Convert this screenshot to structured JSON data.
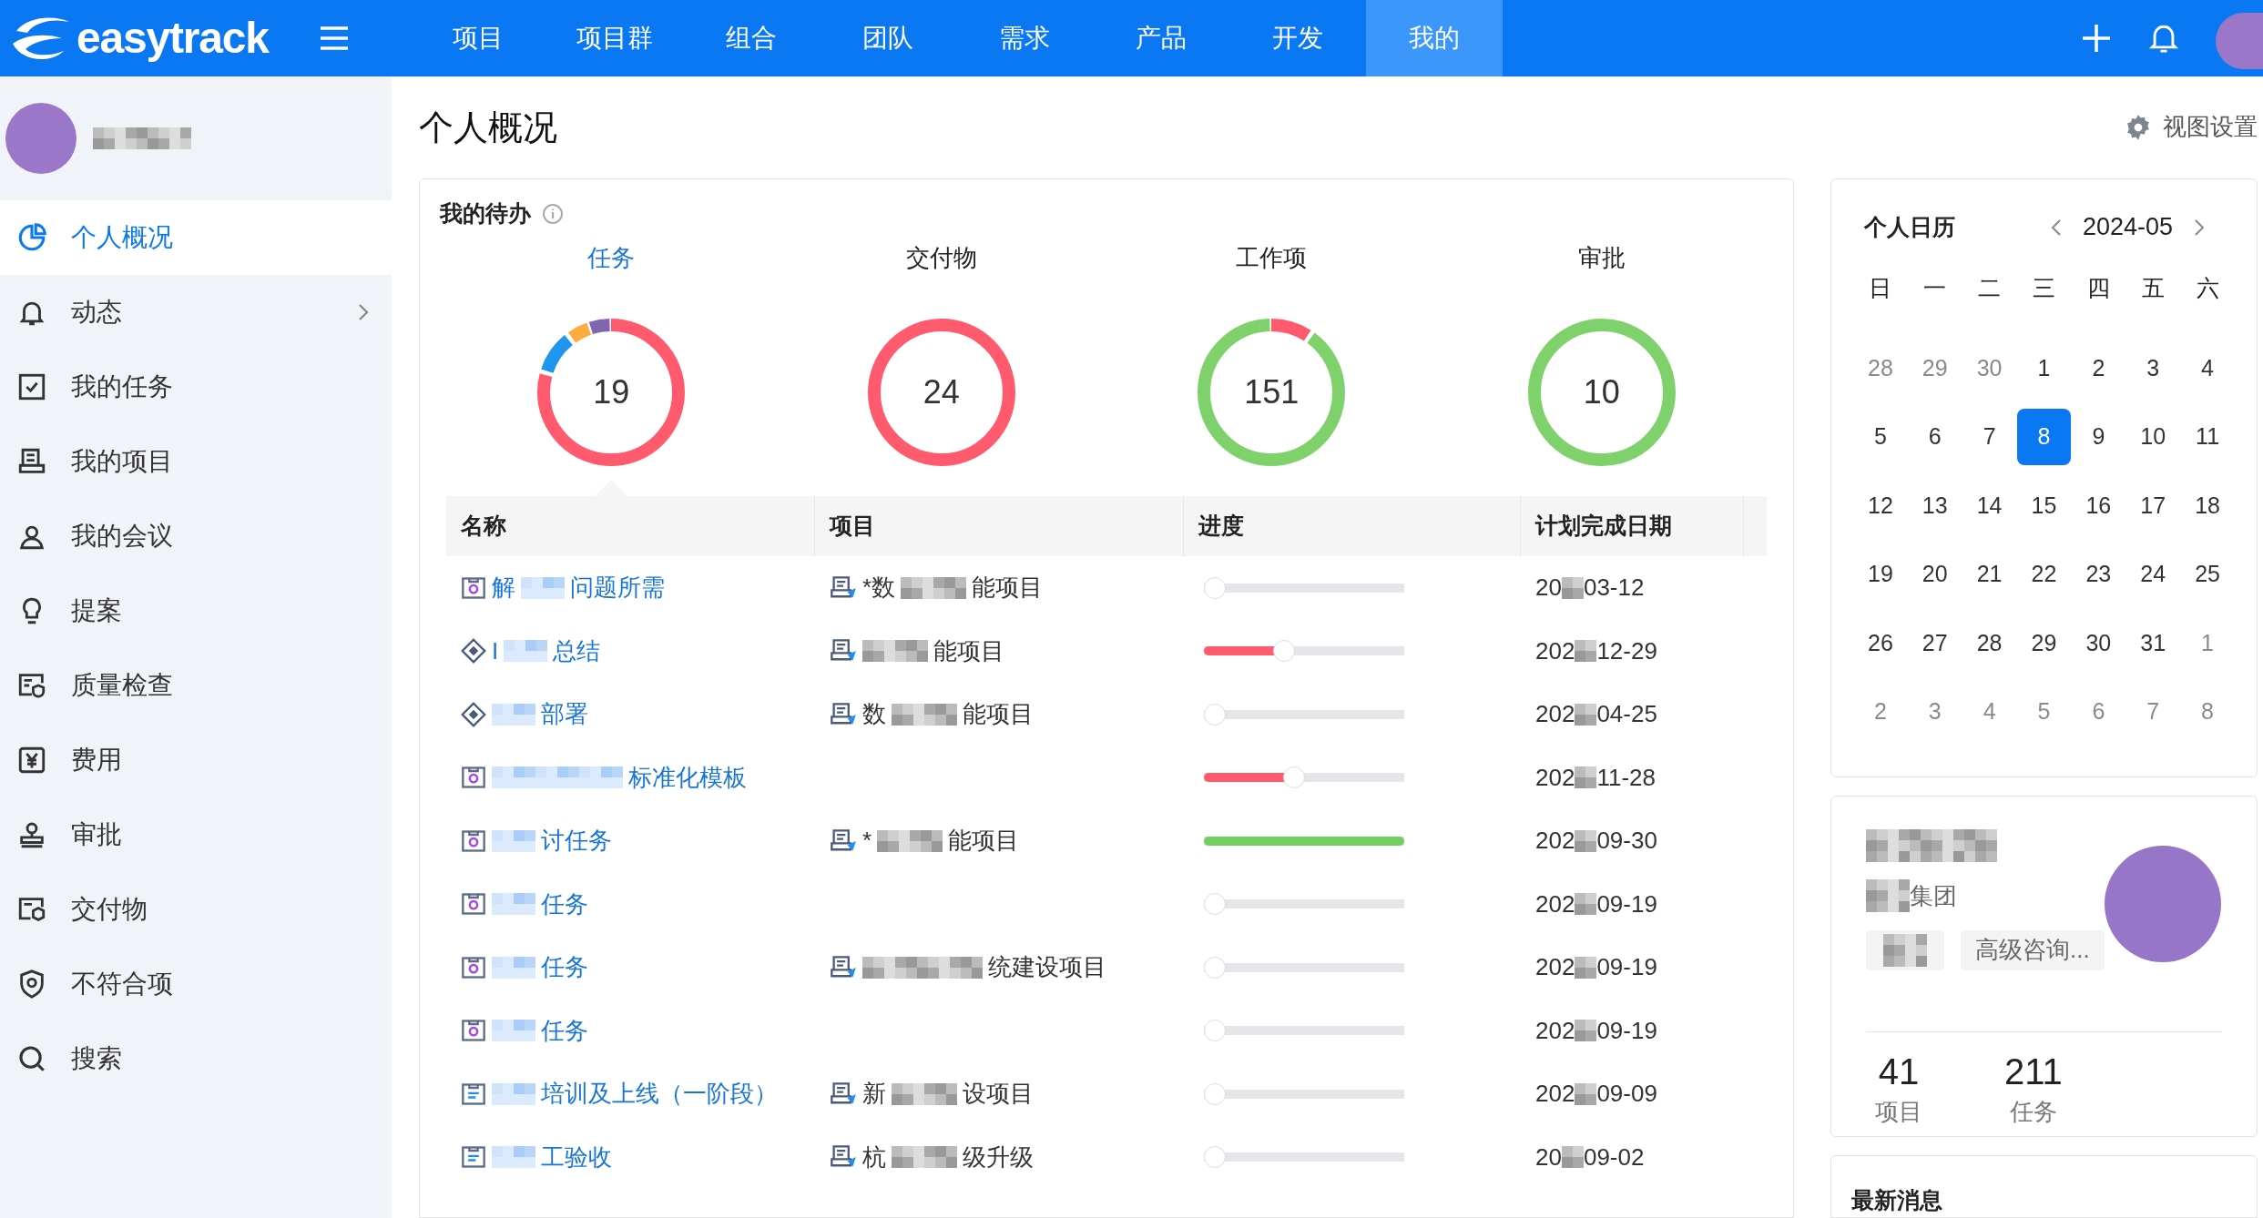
{
  "topbar": {
    "logo": "easytrack",
    "nav": [
      {
        "label": "项目",
        "selected": false
      },
      {
        "label": "项目群",
        "selected": false
      },
      {
        "label": "组合",
        "selected": false
      },
      {
        "label": "团队",
        "selected": false
      },
      {
        "label": "需求",
        "selected": false
      },
      {
        "label": "产品",
        "selected": false
      },
      {
        "label": "开发",
        "selected": false
      },
      {
        "label": "我的",
        "selected": true
      }
    ]
  },
  "sidebar": {
    "items": [
      {
        "label": "个人概况",
        "selected": true,
        "has_children": false
      },
      {
        "label": "动态",
        "selected": false,
        "has_children": true
      },
      {
        "label": "我的任务",
        "selected": false,
        "has_children": false
      },
      {
        "label": "我的项目",
        "selected": false,
        "has_children": false
      },
      {
        "label": "我的会议",
        "selected": false,
        "has_children": false
      },
      {
        "label": "提案",
        "selected": false,
        "has_children": false
      },
      {
        "label": "质量检查",
        "selected": false,
        "has_children": false
      },
      {
        "label": "费用",
        "selected": false,
        "has_children": false
      },
      {
        "label": "审批",
        "selected": false,
        "has_children": false
      },
      {
        "label": "交付物",
        "selected": false,
        "has_children": false
      },
      {
        "label": "不符合项",
        "selected": false,
        "has_children": false
      },
      {
        "label": "搜索",
        "selected": false,
        "has_children": false
      }
    ]
  },
  "page_title": "个人概况",
  "view_settings": "视图设置",
  "todo": {
    "title": "我的待办",
    "tabs": [
      {
        "label": "任务",
        "count": "19",
        "selected": true
      },
      {
        "label": "交付物",
        "count": "24",
        "selected": false
      },
      {
        "label": "工作项",
        "count": "151",
        "selected": false
      },
      {
        "label": "审批",
        "count": "10",
        "selected": false
      }
    ],
    "table": {
      "columns": [
        "名称",
        "项目",
        "进度",
        "计划完成日期"
      ],
      "rows": [
        {
          "kind": "task",
          "name_head": "解",
          "name": "问题所需",
          "project_head": "*数",
          "project": "能项目",
          "level": 0,
          "date_head": "20",
          "date": "03-12"
        },
        {
          "kind": "milestone",
          "name_head": "I",
          "name": "总结",
          "project_head": "",
          "project": "能项目",
          "level": 0.4,
          "date_head": "202",
          "date": "12-29"
        },
        {
          "kind": "milestone",
          "name_head": "",
          "name": "部署",
          "project_head": "数",
          "project": "能项目",
          "level": 0,
          "date_head": "202",
          "date": "04-25"
        },
        {
          "kind": "task",
          "name_head": "",
          "name": "标准化模板",
          "project_head": "",
          "project": "",
          "level": 0.45,
          "date_head": "202",
          "date": "11-28"
        },
        {
          "kind": "task",
          "name_head": "",
          "name": "讨任务",
          "project_head": "*",
          "project": "能项目",
          "level": 1,
          "date_head": "202",
          "date": "09-30"
        },
        {
          "kind": "task",
          "name_head": "",
          "name": "任务",
          "project_head": "",
          "project": "",
          "level": 0,
          "date_head": "202",
          "date": "09-19"
        },
        {
          "kind": "task",
          "name_head": "",
          "name": "任务",
          "project_head": "",
          "project": "统建设项目",
          "level": 0,
          "date_head": "202",
          "date": "09-19"
        },
        {
          "kind": "task",
          "name_head": "",
          "name": "任务",
          "project_head": "",
          "project": "",
          "level": 0,
          "date_head": "202",
          "date": "09-19"
        },
        {
          "kind": "doc",
          "name_head": "",
          "name": "培训及上线（一阶段）",
          "project_head": "新",
          "project": "设项目",
          "level": 0,
          "date_head": "202",
          "date": "09-09"
        },
        {
          "kind": "doc",
          "name_head": "",
          "name": "工验收",
          "project_head": "杭",
          "project": "级升级",
          "level": 0,
          "date_head": "20",
          "date": "09-02"
        }
      ]
    }
  },
  "calendar": {
    "title": "个人日历",
    "month": "2024-05",
    "weekdays": [
      "日",
      "一",
      "二",
      "三",
      "四",
      "五",
      "六"
    ],
    "days": [
      {
        "label": "28",
        "muted": true,
        "selected": false
      },
      {
        "label": "29",
        "muted": true,
        "selected": false
      },
      {
        "label": "30",
        "muted": true,
        "selected": false
      },
      {
        "label": "1",
        "muted": false,
        "selected": false
      },
      {
        "label": "2",
        "muted": false,
        "selected": false
      },
      {
        "label": "3",
        "muted": false,
        "selected": false
      },
      {
        "label": "4",
        "muted": false,
        "selected": false
      },
      {
        "label": "5",
        "muted": false,
        "selected": false
      },
      {
        "label": "6",
        "muted": false,
        "selected": false
      },
      {
        "label": "7",
        "muted": false,
        "selected": false
      },
      {
        "label": "8",
        "muted": false,
        "selected": true
      },
      {
        "label": "9",
        "muted": false,
        "selected": false
      },
      {
        "label": "10",
        "muted": false,
        "selected": false
      },
      {
        "label": "11",
        "muted": false,
        "selected": false
      },
      {
        "label": "12",
        "muted": false,
        "selected": false
      },
      {
        "label": "13",
        "muted": false,
        "selected": false
      },
      {
        "label": "14",
        "muted": false,
        "selected": false
      },
      {
        "label": "15",
        "muted": false,
        "selected": false
      },
      {
        "label": "16",
        "muted": false,
        "selected": false
      },
      {
        "label": "17",
        "muted": false,
        "selected": false
      },
      {
        "label": "18",
        "muted": false,
        "selected": false
      },
      {
        "label": "19",
        "muted": false,
        "selected": false
      },
      {
        "label": "20",
        "muted": false,
        "selected": false
      },
      {
        "label": "21",
        "muted": false,
        "selected": false
      },
      {
        "label": "22",
        "muted": false,
        "selected": false
      },
      {
        "label": "23",
        "muted": false,
        "selected": false
      },
      {
        "label": "24",
        "muted": false,
        "selected": false
      },
      {
        "label": "25",
        "muted": false,
        "selected": false
      },
      {
        "label": "26",
        "muted": false,
        "selected": false
      },
      {
        "label": "27",
        "muted": false,
        "selected": false
      },
      {
        "label": "28",
        "muted": false,
        "selected": false
      },
      {
        "label": "29",
        "muted": false,
        "selected": false
      },
      {
        "label": "30",
        "muted": false,
        "selected": false
      },
      {
        "label": "31",
        "muted": false,
        "selected": false
      },
      {
        "label": "1",
        "muted": true,
        "selected": false
      },
      {
        "label": "2",
        "muted": true,
        "selected": false
      },
      {
        "label": "3",
        "muted": true,
        "selected": false
      },
      {
        "label": "4",
        "muted": true,
        "selected": false
      },
      {
        "label": "5",
        "muted": true,
        "selected": false
      },
      {
        "label": "6",
        "muted": true,
        "selected": false
      },
      {
        "label": "7",
        "muted": true,
        "selected": false
      },
      {
        "label": "8",
        "muted": true,
        "selected": false
      }
    ]
  },
  "profile": {
    "org": "集团",
    "tags": [
      "高级咨询..."
    ],
    "stats": [
      {
        "value": "41",
        "label": "项目"
      },
      {
        "value": "211",
        "label": "任务"
      }
    ]
  },
  "news": {
    "title": "最新消息"
  }
}
